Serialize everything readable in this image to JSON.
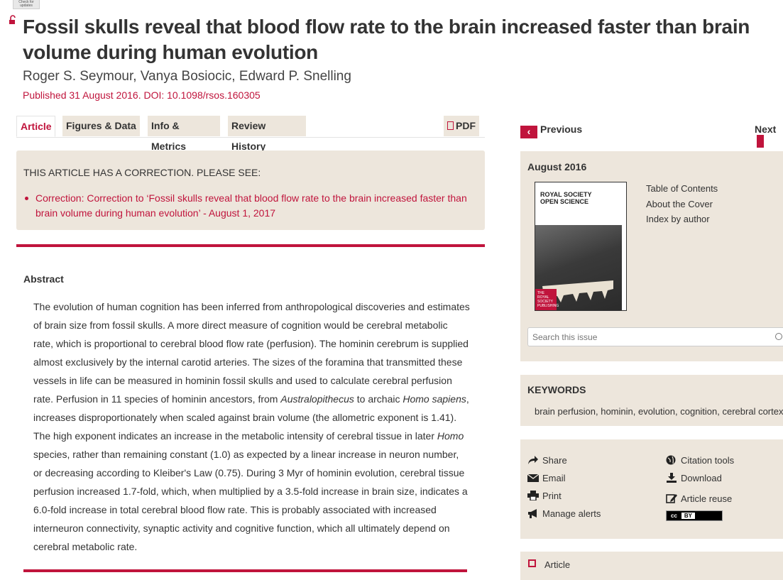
{
  "header": {
    "check_updates": "Check for updates",
    "title": "Fossil skulls reveal that blood flow rate to the brain increased faster than brain volume during human evolution",
    "authors": "Roger S. Seymour, Vanya Bosiocic, Edward P. Snelling",
    "published": "Published 31 August 2016. DOI: 10.1098/rsos.160305"
  },
  "tabs": [
    {
      "label": "Article"
    },
    {
      "label": "Figures & Data"
    },
    {
      "label": "Info & Metrics"
    },
    {
      "label": "Review History"
    }
  ],
  "pdf_label": "PDF",
  "correction": {
    "heading": "THIS ARTICLE HAS A CORRECTION. PLEASE SEE:",
    "link": "Correction: Correction to ‘Fossil skulls reveal that blood flow rate to the brain increased faster than brain volume during human evolution’ - August 1, 2017"
  },
  "abstract": {
    "heading": "Abstract",
    "p1": "The evolution of human cognition has been inferred from anthropological discoveries and estimates of brain size from fossil skulls. A more direct measure of cognition would be cerebral metabolic rate, which is proportional to cerebral blood flow rate (perfusion). The hominin cerebrum is supplied almost exclusively by the internal carotid arteries. The sizes of the foramina that transmitted these vessels in life can be measured in hominin fossil skulls and used to calculate cerebral perfusion rate. Perfusion in 11 species of hominin ancestors, from ",
    "i1": "Australopithecus",
    "p2": " to archaic ",
    "i2": "Homo sapiens",
    "p3": ", increases disproportionately when scaled against brain volume (the allometric exponent is 1.41). The high exponent indicates an increase in the metabolic intensity of cerebral tissue in later ",
    "i3": "Homo",
    "p4": " species, rather than remaining constant (1.0) as expected by a linear increase in neuron number, or decreasing according to Kleiber's Law (0.75). During 3 Myr of hominin evolution, cerebral tissue perfusion increased 1.7-fold, which, when multiplied by a 3.5-fold increase in brain size, indicates a 6.0-fold increase in total cerebral blood flow rate. This is probably associated with increased interneuron connectivity, synaptic activity and cognitive function, which all ultimately depend on cerebral metabolic rate."
  },
  "nav": {
    "previous": "Previous",
    "next": "Next"
  },
  "issue": {
    "date": "August 2016",
    "cover_title_1": "ROYAL SOCIETY",
    "cover_title_2": "OPEN SCIENCE",
    "cover_logo": "THE ROYAL SOCIETY PUBLISHING",
    "links": [
      "Table of Contents",
      "About the Cover",
      "Index by author"
    ],
    "search_placeholder": "Search this issue"
  },
  "keywords": {
    "heading": "KEYWORDS",
    "list": "brain perfusion, hominin, evolution, cognition, cerebral cortex"
  },
  "tools": {
    "share": "Share",
    "email": "Email",
    "print": "Print",
    "manage_alerts": "Manage alerts",
    "citation_tools": "Citation tools",
    "download": "Download",
    "article_reuse": "Article reuse",
    "cc_badge": "cc",
    "cc_by": "BY"
  },
  "article_section": {
    "label": "Article"
  },
  "colors": {
    "accent": "#c0143c",
    "panel": "#ede6dc"
  }
}
